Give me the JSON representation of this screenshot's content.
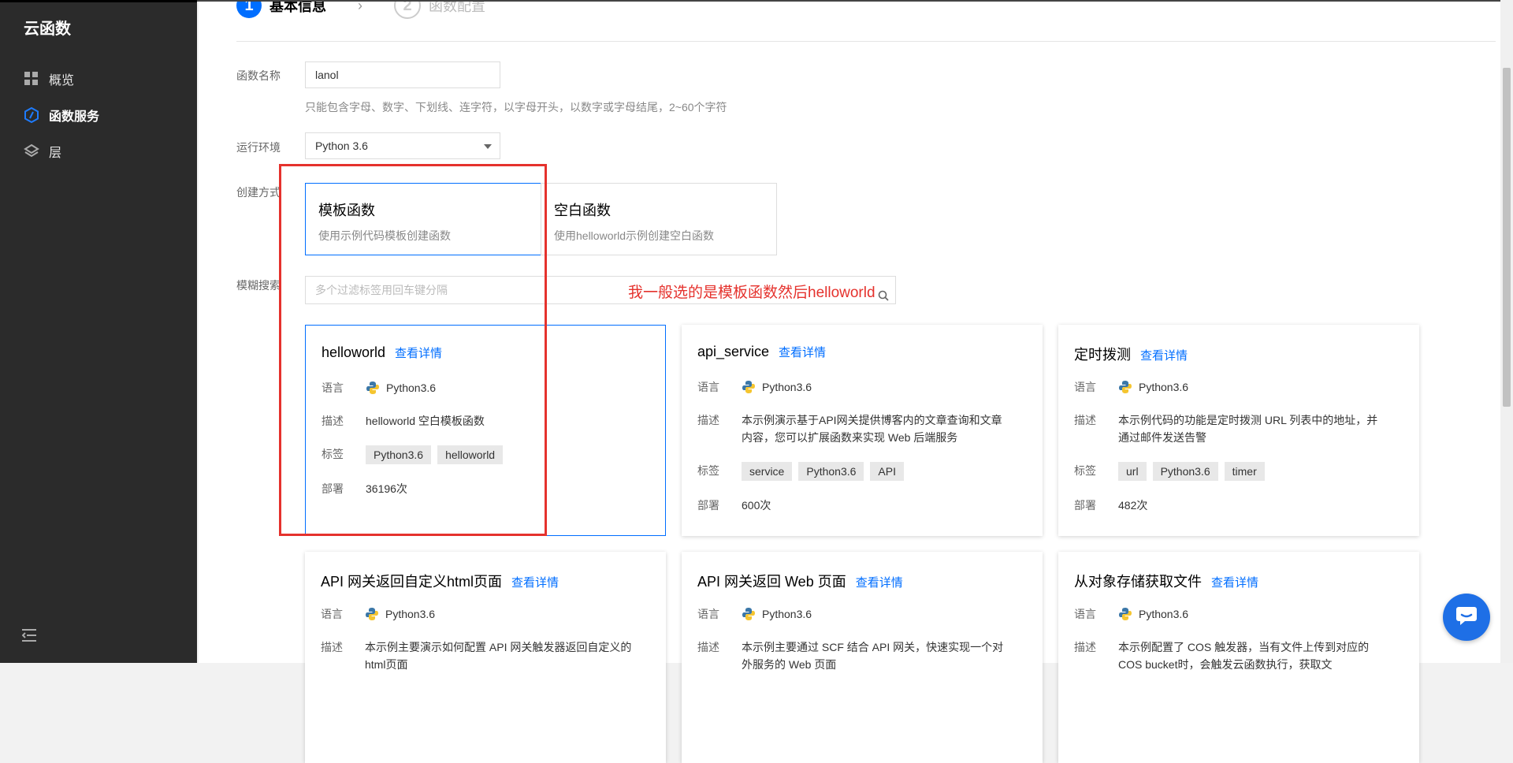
{
  "sidebar": {
    "title": "云函数",
    "items": [
      {
        "label": "概览",
        "icon": "grid-icon"
      },
      {
        "label": "函数服务",
        "icon": "function-icon",
        "active": true
      },
      {
        "label": "层",
        "icon": "layers-icon"
      }
    ],
    "collapse_icon": "collapse-menu-icon"
  },
  "steps": [
    {
      "num": "1",
      "label": "基本信息",
      "active": true
    },
    {
      "num": "2",
      "label": "函数配置",
      "active": false
    }
  ],
  "form": {
    "name_label": "函数名称",
    "name_value": "lanol",
    "name_hint": "只能包含字母、数字、下划线、连字符，以字母开头，以数字或字母结尾，2~60个字符",
    "runtime_label": "运行环境",
    "runtime_value": "Python 3.6",
    "method_label": "创建方式",
    "methods": [
      {
        "title": "模板函数",
        "desc": "使用示例代码模板创建函数",
        "selected": true
      },
      {
        "title": "空白函数",
        "desc": "使用helloworld示例创建空白函数",
        "selected": false
      }
    ],
    "search_label": "模糊搜索",
    "search_placeholder": "多个过滤标签用回车键分隔"
  },
  "annotation": "我一般选的是模板函数然后helloworld",
  "card_labels": {
    "lang": "语言",
    "desc": "描述",
    "tags": "标签",
    "deploy": "部署"
  },
  "templates": [
    {
      "title": "helloworld",
      "link": "查看详情",
      "lang": "Python3.6",
      "desc": "helloworld 空白模板函数",
      "tags": [
        "Python3.6",
        "helloworld"
      ],
      "deploy": "36196次",
      "selected": true
    },
    {
      "title": "api_service",
      "link": "查看详情",
      "lang": "Python3.6",
      "desc": "本示例演示基于API网关提供博客内的文章查询和文章内容，您可以扩展函数来实现 Web 后端服务",
      "tags": [
        "service",
        "Python3.6",
        "API"
      ],
      "deploy": "600次"
    },
    {
      "title": "定时拨测",
      "link": "查看详情",
      "lang": "Python3.6",
      "desc": "本示例代码的功能是定时拨测 URL 列表中的地址，并通过邮件发送告警",
      "tags": [
        "url",
        "Python3.6",
        "timer"
      ],
      "deploy": "482次"
    },
    {
      "title": "API 网关返回自定义html页面",
      "link": "查看详情",
      "lang": "Python3.6",
      "desc": "本示例主要演示如何配置 API 网关触发器返回自定义的html页面"
    },
    {
      "title": "API 网关返回 Web 页面",
      "link": "查看详情",
      "lang": "Python3.6",
      "desc": "本示例主要通过 SCF 结合 API 网关，快速实现一个对外服务的 Web 页面"
    },
    {
      "title": "从对象存储获取文件",
      "link": "查看详情",
      "lang": "Python3.6",
      "desc": "本示例配置了 COS 触发器，当有文件上传到对应的 COS bucket时，会触发云函数执行，获取文"
    }
  ],
  "colors": {
    "primary": "#006eff",
    "annotation": "#e5322d",
    "sidebar": "#2b2b2b"
  }
}
